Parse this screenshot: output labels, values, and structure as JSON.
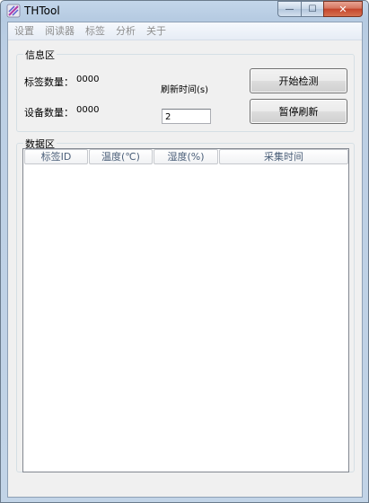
{
  "window": {
    "title": "THTool",
    "min_glyph": "—",
    "max_glyph": "☐",
    "close_glyph": "✕"
  },
  "menu": [
    "设置",
    "阅读器",
    "标签",
    "分析",
    "关于"
  ],
  "info_group": {
    "title": "信息区",
    "tag_count_label": "标签数量：",
    "tag_count_value": "0000",
    "device_count_label": "设备数量：",
    "device_count_value": "0000",
    "refresh_label": "刷新时间(s)",
    "refresh_value": "2",
    "start_button": "开始检测",
    "pause_button": "暂停刷新"
  },
  "data_group": {
    "title": "数据区",
    "columns": [
      "标签ID",
      "温度(℃)",
      "湿度(%)",
      "采集时间"
    ]
  },
  "colors": {
    "title_bar": "#b9cde3",
    "client_bg": "#f0f0f0",
    "menu_disabled_text": "#8f8f8f",
    "close_button": "#c4452c"
  },
  "icons": {
    "app_icon": "pencil-stripes-icon"
  }
}
